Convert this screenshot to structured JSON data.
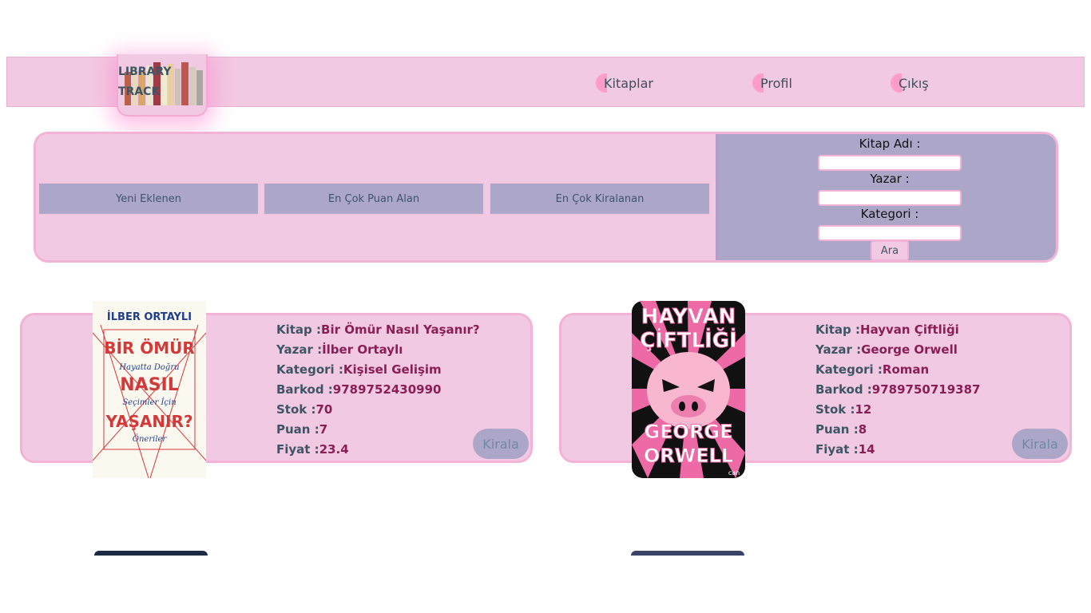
{
  "header": {
    "logo_line1": "LIBRARY",
    "logo_line2": "TRACK",
    "nav": [
      {
        "label": "Kitaplar"
      },
      {
        "label": "Profil"
      },
      {
        "label": "Çıkış"
      }
    ]
  },
  "filters": {
    "sort_buttons": [
      "Yeni Eklenen",
      "En Çok Puan Alan",
      "En Çok Kiralanan"
    ],
    "search": {
      "title_label": "Kitap Adı :",
      "title_value": "",
      "author_label": "Yazar :",
      "author_value": "",
      "category_label": "Kategori :",
      "category_value": "",
      "submit_label": "Ara"
    }
  },
  "labels": {
    "book": "Kitap :",
    "author": "Yazar :",
    "category": "Kategori :",
    "barcode": "Barkod :",
    "stock": "Stok :",
    "rating": "Puan :",
    "price": "Fiyat :",
    "rent": "Kirala"
  },
  "books": [
    {
      "title": "Bir Ömür Nasıl Yaşanır?",
      "author": "İlber Ortaylı",
      "category": "Kişisel Gelişim",
      "barcode": "9789752430990",
      "stock": "70",
      "rating": "7",
      "price": "23.4",
      "cover": {
        "author": "İLBER ORTAYLI",
        "line1": "BİR ÖMÜR",
        "sub1": "Hayatta Doğru",
        "line2": "NASIL",
        "sub2": "Seçimler İçin",
        "line3": "YAŞANIR?",
        "sub3": "Öneriler"
      }
    },
    {
      "title": "Hayvan Çiftliği",
      "author": "George Orwell",
      "category": "Roman",
      "barcode": "9789750719387",
      "stock": "12",
      "rating": "8",
      "price": "14",
      "cover": {
        "line1": "HAYVAN",
        "line2": "ÇİFTLİĞİ",
        "author1": "GEORGE",
        "author2": "ORWELL",
        "publisher": "can"
      }
    }
  ],
  "colors": {
    "pink_bg": "#f2c9e2",
    "pink_border": "#f2b3d7",
    "lavender": "#aca6c9",
    "label_text": "#3e5566",
    "value_text": "#8a1f55"
  }
}
